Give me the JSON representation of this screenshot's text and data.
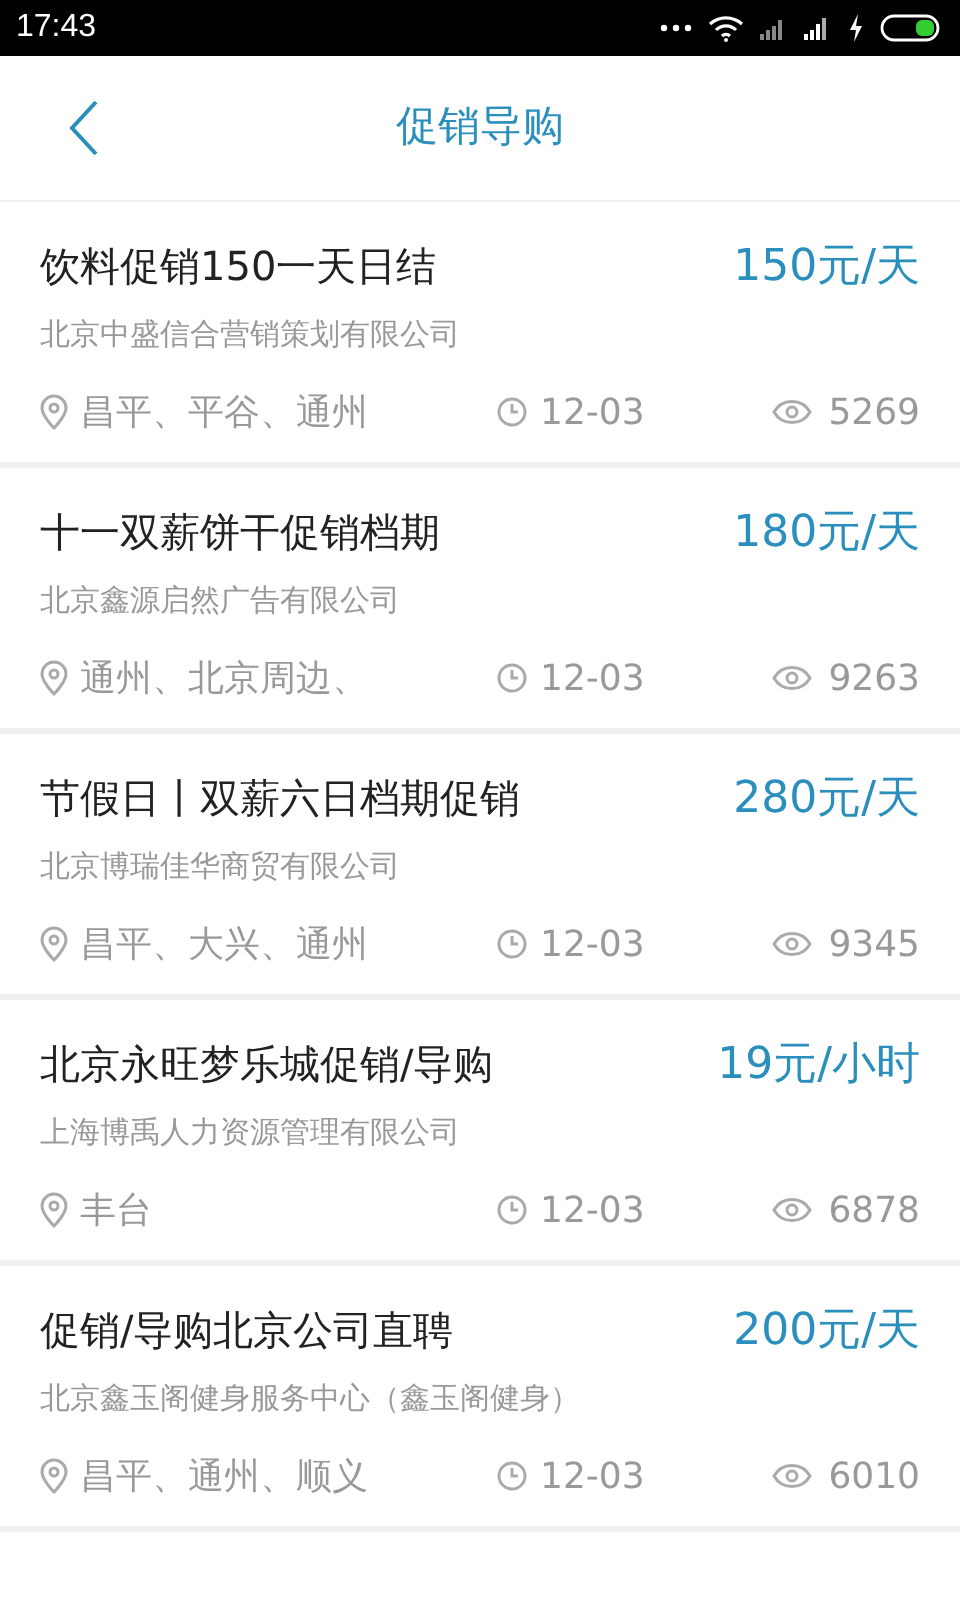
{
  "status_bar": {
    "time": "17:43"
  },
  "header": {
    "title": "促销导购"
  },
  "jobs": [
    {
      "title": "饮料促销150一天日结",
      "pay": "150元/天",
      "company": "北京中盛信合营销策划有限公司",
      "location": "昌平、平谷、通州",
      "date": "12-03",
      "views": "5269"
    },
    {
      "title": "十一双薪饼干促销档期",
      "pay": "180元/天",
      "company": "北京鑫源启然广告有限公司",
      "location": "通州、北京周边、",
      "date": "12-03",
      "views": "9263"
    },
    {
      "title": "节假日丨双薪六日档期促销",
      "pay": "280元/天",
      "company": "北京博瑞佳华商贸有限公司",
      "location": "昌平、大兴、通州",
      "date": "12-03",
      "views": "9345"
    },
    {
      "title": "北京永旺梦乐城促销/导购",
      "pay": "19元/小时",
      "company": "上海博禹人力资源管理有限公司",
      "location": "丰台",
      "date": "12-03",
      "views": "6878"
    },
    {
      "title": "促销/导购北京公司直聘",
      "pay": "200元/天",
      "company": "北京鑫玉阁健身服务中心（鑫玉阁健身）",
      "location": "昌平、通州、顺义",
      "date": "12-03",
      "views": "6010"
    }
  ]
}
